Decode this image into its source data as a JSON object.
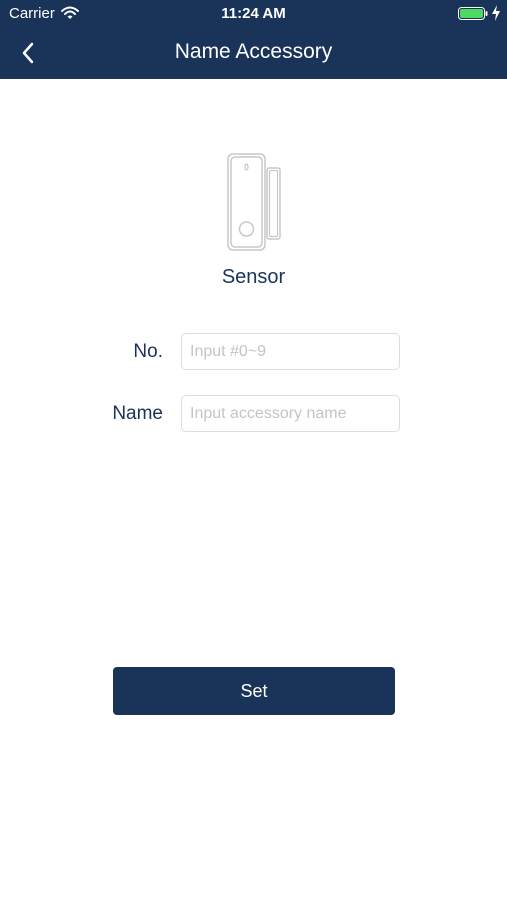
{
  "status_bar": {
    "carrier": "Carrier",
    "time": "11:24 AM",
    "battery_level": 1.0,
    "battery_color": "#4cd964"
  },
  "nav": {
    "title": "Name Accessory",
    "back_icon": "chevron-left-icon"
  },
  "device": {
    "icon": "door-sensor-icon",
    "label": "Sensor"
  },
  "form": {
    "no_label": "No.",
    "no_placeholder": "Input #0~9",
    "no_value": "",
    "name_label": "Name",
    "name_placeholder": "Input accessory name",
    "name_value": ""
  },
  "actions": {
    "set_label": "Set"
  },
  "colors": {
    "primary": "#1a3359",
    "background": "#ffffff",
    "input_border": "#dddddd",
    "placeholder": "#c4c4c4"
  }
}
